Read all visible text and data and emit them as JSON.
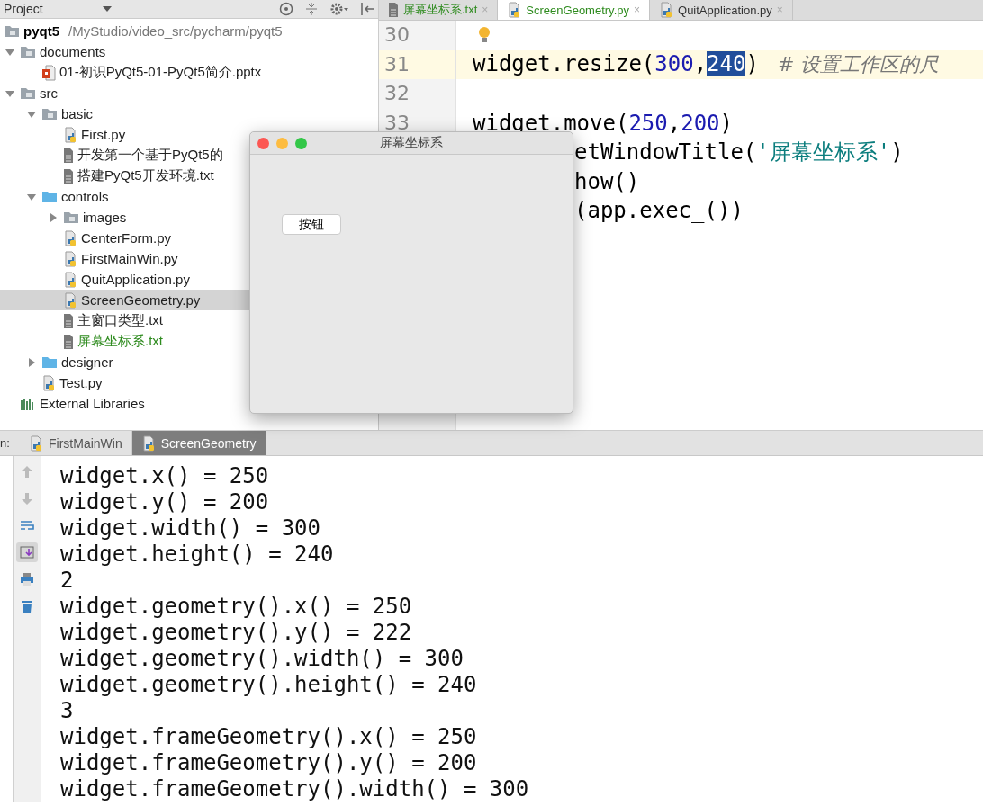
{
  "project_panel": {
    "title": "Project",
    "root": {
      "name": "pyqt5",
      "path": "/MyStudio/video_src/pycharm/pyqt5"
    },
    "tree": [
      {
        "name": "documents",
        "kind": "folder",
        "expanded": true,
        "selected": false,
        "color": "#222222",
        "children": [
          {
            "name": "01-初识PyQt5-01-PyQt5简介.pptx",
            "kind": "slides",
            "selected": false,
            "color": "#222222"
          }
        ]
      },
      {
        "name": "src",
        "kind": "folder",
        "expanded": true,
        "selected": false,
        "color": "#222222",
        "children": [
          {
            "name": "basic",
            "kind": "folder",
            "expanded": true,
            "selected": false,
            "color": "#222222",
            "children": [
              {
                "name": "First.py",
                "kind": "python",
                "selected": false,
                "color": "#222222"
              },
              {
                "name": "开发第一个基于PyQt5的",
                "kind": "text",
                "selected": false,
                "color": "#222222"
              },
              {
                "name": "搭建PyQt5开发环境.txt",
                "kind": "text",
                "selected": false,
                "color": "#222222"
              }
            ]
          },
          {
            "name": "controls",
            "kind": "source-folder",
            "expanded": true,
            "selected": false,
            "color": "#222222",
            "children": [
              {
                "name": "images",
                "kind": "folder",
                "expanded": false,
                "selected": false,
                "color": "#222222"
              },
              {
                "name": "CenterForm.py",
                "kind": "python",
                "selected": false,
                "color": "#222222"
              },
              {
                "name": "FirstMainWin.py",
                "kind": "python",
                "selected": false,
                "color": "#222222"
              },
              {
                "name": "QuitApplication.py",
                "kind": "python",
                "selected": false,
                "color": "#222222"
              },
              {
                "name": "ScreenGeometry.py",
                "kind": "python",
                "selected": true,
                "color": "#222222"
              },
              {
                "name": "主窗口类型.txt",
                "kind": "text",
                "selected": false,
                "color": "#222222"
              },
              {
                "name": "屏幕坐标系.txt",
                "kind": "text",
                "selected": false,
                "color": "#2e8b1e"
              }
            ]
          },
          {
            "name": "designer",
            "kind": "source-folder",
            "expanded": false,
            "selected": false,
            "color": "#222222"
          },
          {
            "name": "Test.py",
            "kind": "python",
            "selected": false,
            "color": "#222222"
          }
        ]
      },
      {
        "name": "External Libraries",
        "kind": "library",
        "selected": false,
        "color": "#222222"
      }
    ]
  },
  "editor": {
    "tabs": [
      {
        "label": "屏幕坐标系.txt",
        "kind": "text",
        "selected": false,
        "color": "#2e8b1e",
        "close": "×"
      },
      {
        "label": "ScreenGeometry.py",
        "kind": "python",
        "selected": true,
        "color": "#2e8b1e",
        "close": "×"
      },
      {
        "label": "QuitApplication.py",
        "kind": "python",
        "selected": false,
        "color": "#333333",
        "close": "×"
      }
    ],
    "lines": [
      {
        "number": "30",
        "hint": true,
        "current": false
      },
      {
        "number": "31",
        "hint": false,
        "current": true,
        "cut": false,
        "segments": [
          {
            "kind": "plain",
            "text": "widget.resize("
          },
          {
            "kind": "number",
            "text": "300"
          },
          {
            "kind": "plain",
            "text": ","
          },
          {
            "kind": "selected",
            "text": "240"
          },
          {
            "kind": "plain",
            "text": ")"
          },
          {
            "kind": "comment",
            "text": "   # 设置工作区的尺"
          }
        ]
      },
      {
        "number": "32",
        "hint": false,
        "current": false
      },
      {
        "number": "33",
        "hint": false,
        "current": false,
        "cut": false,
        "segments": [
          {
            "kind": "plain",
            "text": "widget.move("
          },
          {
            "kind": "number",
            "text": "250"
          },
          {
            "kind": "plain",
            "text": ","
          },
          {
            "kind": "number",
            "text": "200"
          },
          {
            "kind": "plain",
            "text": ")"
          }
        ]
      },
      {
        "hint": false,
        "current": false,
        "cut": true,
        "segments": [
          {
            "kind": "plain",
            "text": "etWindowTitle("
          },
          {
            "kind": "string",
            "text": "'屏幕坐标系'"
          },
          {
            "kind": "plain",
            "text": ")"
          }
        ]
      },
      {
        "hint": false,
        "current": false,
        "cut": true,
        "segments": [
          {
            "kind": "plain",
            "text": "how()"
          }
        ]
      },
      {
        "hint": false,
        "current": false,
        "cut": true,
        "segments": [
          {
            "kind": "plain",
            "text": "(app.exec_())"
          }
        ]
      }
    ]
  },
  "dialog": {
    "title": "屏幕坐标系",
    "button": "按钮"
  },
  "run_panel": {
    "label": "n:",
    "tabs": [
      {
        "label": "FirstMainWin",
        "selected": false
      },
      {
        "label": "ScreenGeometry",
        "selected": true
      }
    ],
    "tools": [
      {
        "kind": "up",
        "selected": false
      },
      {
        "kind": "down",
        "selected": false
      },
      {
        "kind": "wrap",
        "selected": false
      },
      {
        "kind": "scroll-end",
        "selected": true
      },
      {
        "kind": "print",
        "selected": false
      },
      {
        "kind": "trash",
        "selected": false
      }
    ],
    "output": [
      "widget.x() = 250",
      "widget.y() = 200",
      "widget.width() = 300",
      "widget.height() = 240",
      "2",
      "widget.geometry().x() = 250",
      "widget.geometry().y() = 222",
      "widget.geometry().width() = 300",
      "widget.geometry().height() = 240",
      "3",
      "widget.frameGeometry().x() = 250",
      "widget.frameGeometry().y() = 200",
      "widget.frameGeometry().width() = 300"
    ]
  }
}
